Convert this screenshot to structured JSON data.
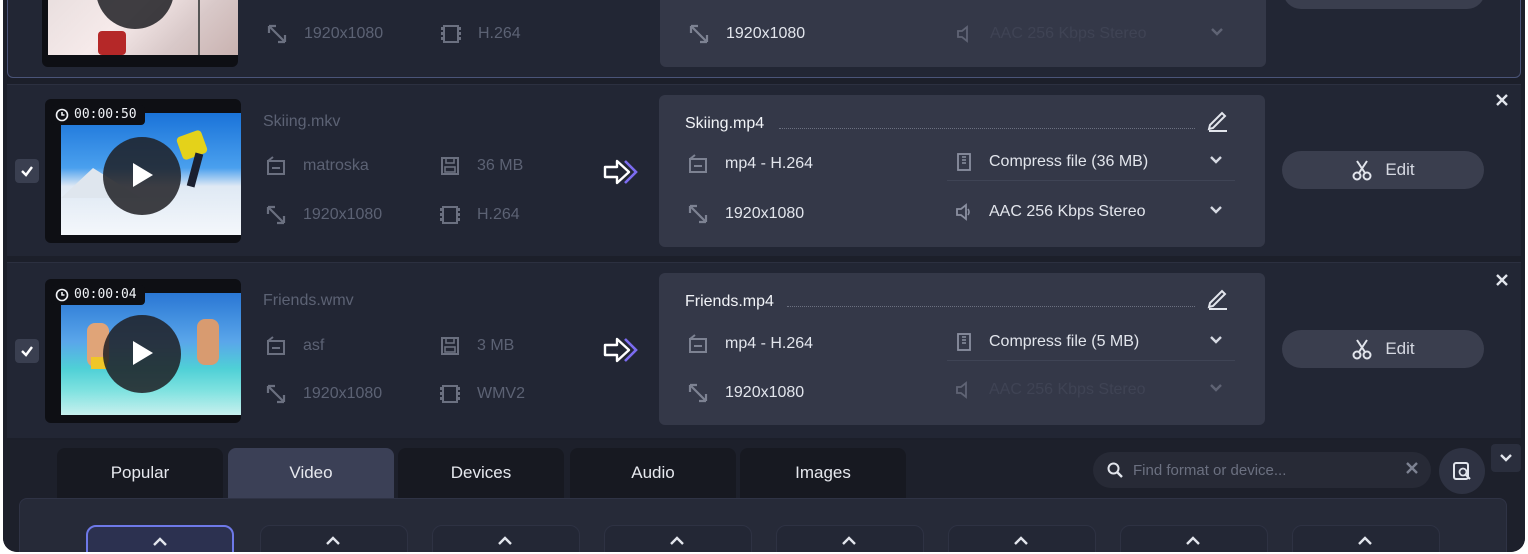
{
  "files": [
    {
      "source": {
        "resolution": "1920x1080",
        "codec": "H.264"
      },
      "output": {
        "resolution": "1920x1080",
        "audio": "AAC 256 Kbps Stereo"
      }
    },
    {
      "duration": "00:00:50",
      "source": {
        "name": "Skiing.mkv",
        "container": "matroska",
        "size": "36 MB",
        "resolution": "1920x1080",
        "codec": "H.264"
      },
      "output": {
        "name": "Skiing.mp4",
        "format": "mp4 - H.264",
        "resolution": "1920x1080",
        "compress": "Compress file (36 MB)",
        "audio": "AAC 256 Kbps Stereo"
      },
      "edit_label": "Edit"
    },
    {
      "duration": "00:00:04",
      "source": {
        "name": "Friends.wmv",
        "container": "asf",
        "size": "3 MB",
        "resolution": "1920x1080",
        "codec": "WMV2"
      },
      "output": {
        "name": "Friends.mp4",
        "format": "mp4 - H.264",
        "resolution": "1920x1080",
        "compress": "Compress file (5 MB)",
        "audio": "AAC 256 Kbps Stereo"
      },
      "edit_label": "Edit"
    }
  ],
  "tabs": [
    {
      "label": "Popular",
      "active": false
    },
    {
      "label": "Video",
      "active": true
    },
    {
      "label": "Devices",
      "active": false
    },
    {
      "label": "Audio",
      "active": false
    },
    {
      "label": "Images",
      "active": false
    }
  ],
  "search": {
    "placeholder": "Find format or device..."
  },
  "colors": {
    "background": "#1c1f2a",
    "row": "#222634",
    "output_panel": "#343848",
    "accent": "#6e79e8",
    "arrow": "#ffffff"
  }
}
